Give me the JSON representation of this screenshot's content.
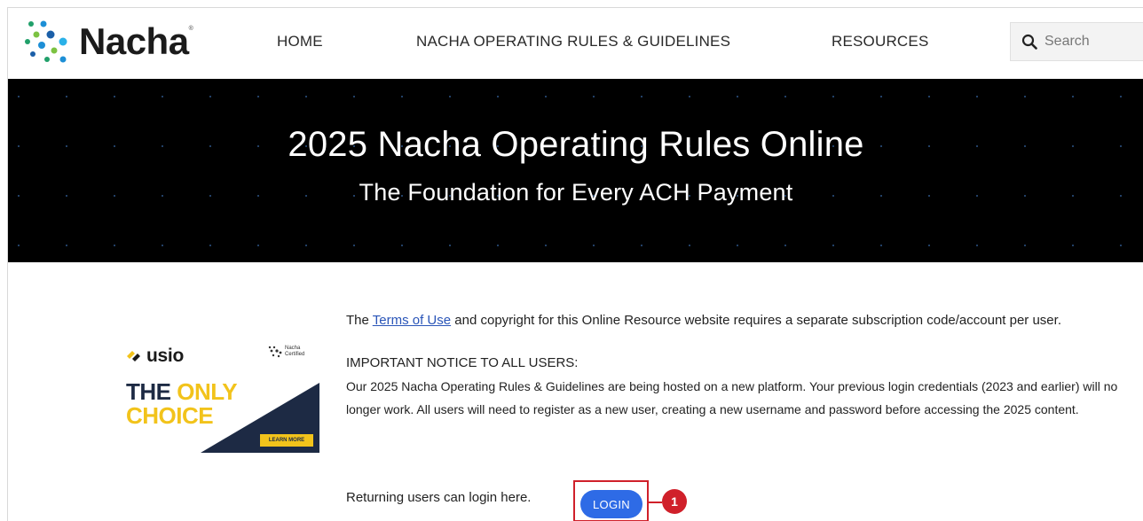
{
  "header": {
    "logo_text": "Nacha",
    "logo_reg": "®",
    "nav": {
      "home": "HOME",
      "rules": "NACHA OPERATING RULES & GUIDELINES",
      "resources": "RESOURCES"
    },
    "search": {
      "placeholder": "Search",
      "icon": "search-icon"
    }
  },
  "hero": {
    "title": "2025 Nacha Operating Rules Online",
    "subtitle": "The Foundation for Every ACH Payment"
  },
  "ad": {
    "brand": "usio",
    "cert_line1": "Nacha",
    "cert_line2": "Certified",
    "headline_dark": "THE",
    "headline_yellow": "ONLY",
    "headline_line2": "CHOICE",
    "button": "LEARN MORE",
    "colors": {
      "navy": "#1d2a44",
      "yellow": "#f2c31b"
    }
  },
  "content": {
    "p1_before": "The ",
    "p1_link": "Terms of Use",
    "p1_after": " and copyright for this Online Resource website requires a separate subscription code/account per user.",
    "notice_title": "IMPORTANT NOTICE TO ALL USERS:",
    "notice_body": "Our 2025 Nacha Operating Rules & Guidelines are being hosted on a new platform. Your previous login credentials (2023 and earlier) will no longer work. All users will need to register as a new user, creating a new username and password before accessing the 2025 content.",
    "returning": "Returning users can login here.",
    "login": "LOGIN"
  },
  "annotation": {
    "step": "1",
    "color": "#d0202a"
  },
  "colors": {
    "link": "#2a55b8",
    "button": "#2e6be6",
    "hero_bg": "#000000"
  }
}
